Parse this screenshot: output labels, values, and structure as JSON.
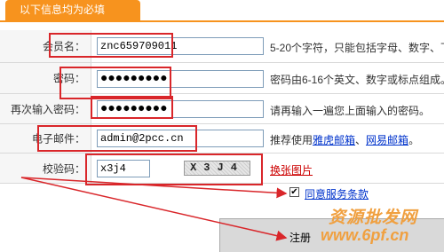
{
  "header": {
    "title": "以下信息均为必填"
  },
  "fields": {
    "username": {
      "label": "会员名：",
      "value": "znc659709011",
      "hint": "5-20个字符，只能包括字母、数字、下划"
    },
    "password": {
      "label": "密码：",
      "value": "●●●●●●●●●",
      "hint": "密码由6-16个英文、数字或标点组成。"
    },
    "confirm": {
      "label": "再次输入密码：",
      "value": "●●●●●●●●●",
      "hint": "请再输入一遍您上面输入的密码。"
    },
    "email": {
      "label": "电子邮件：",
      "value": "admin@2pcc.cn",
      "hint_prefix": "推荐使用",
      "link1": "雅虎邮箱",
      "sep": "、",
      "link2": "网易邮箱",
      "hint_suffix": "。"
    },
    "captcha": {
      "label": "校验码：",
      "value": "x3j4",
      "image_text": "X3J4",
      "refresh": "换张图片"
    }
  },
  "agreement": {
    "checked": true,
    "check_mark": "✔",
    "label": "同意服务条款"
  },
  "register": {
    "label": "注册"
  },
  "watermark": {
    "text": "资源批发网",
    "url": "www.6pf.cn"
  },
  "colors": {
    "accent": "#f7931e",
    "annotation": "#d9262a",
    "link": "#0033cc"
  }
}
